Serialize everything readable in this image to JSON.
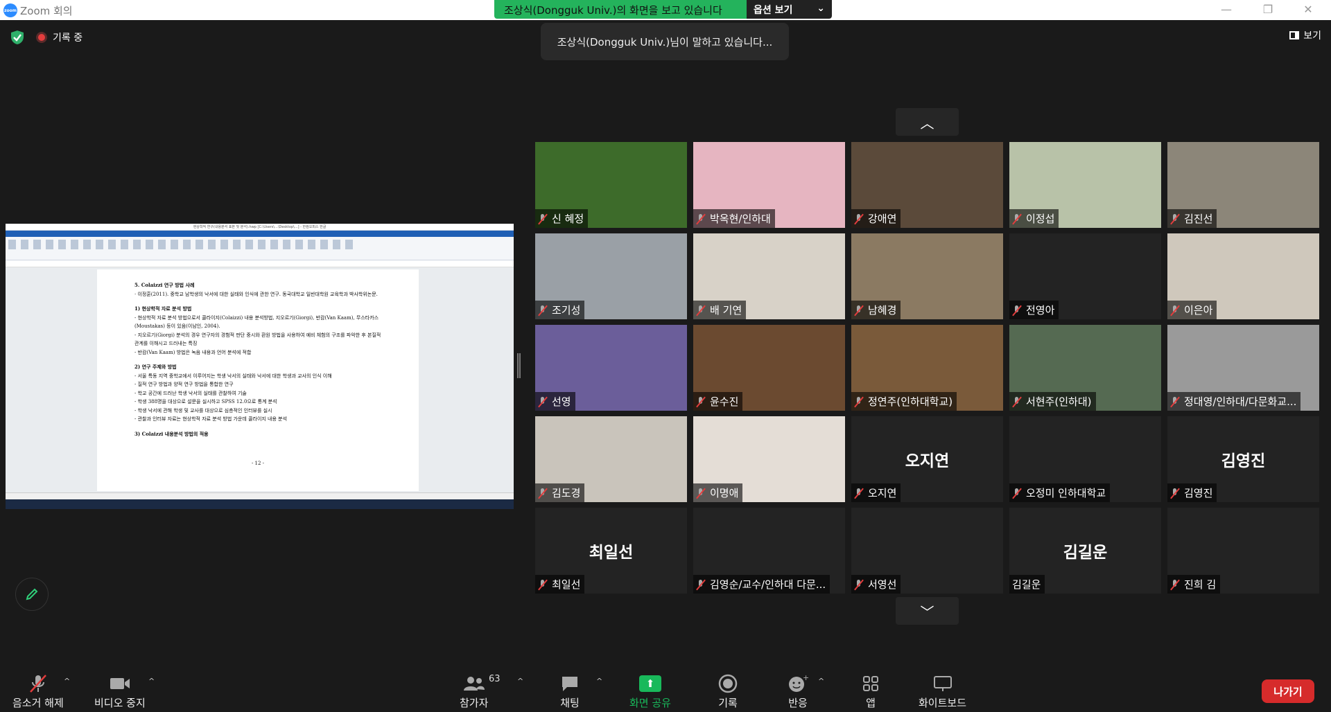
{
  "window": {
    "app_logo": "zoom",
    "title": "Zoom 회의",
    "minimize": "—",
    "restore": "❐",
    "close": "✕"
  },
  "share_banner": {
    "text": "조상식(Dongguk Univ.)의 화면을 보고 있습니다",
    "options_label": "옵션 보기",
    "options_caret": "⌄"
  },
  "recording_label": "기록 중",
  "speaking_text": "조상식(Dongguk Univ.)님이 말하고 있습니다...",
  "view_label": "보기",
  "shared_document": {
    "window_title": "현상학적 연구(내용분석 표본 및 분석).hwp [C:\\Users\\...\\Desktop\\...] - 한컴오피스 한글",
    "lines": [
      {
        "cls": "h",
        "text": "5. Colaizzi 연구 방법 사례"
      },
      {
        "cls": "",
        "text": "· 이정훈(2011). 중학교 남학생의 낙서에 대한 실태와 인식에 관한 연구. 동국대학교 일반대학원 교육학과 박사학위논문."
      },
      {
        "cls": "h",
        "text": "1) 현상학적 자료 분석 방법"
      },
      {
        "cls": "",
        "text": "- 현상학적 자료 분석 방법으로서 콜라이지(Colaizzi) 내용 분석방법, 지오르기(Giorgi), 반캄(Van Kaam), 무스타카스(Moustakas) 등이 있음(이남인, 2004)."
      },
      {
        "cls": "",
        "text": "- 지오르기(Giorgi) 분석의 경우 연구자의 경험적 판단 중시와 환원 방법을 사용하여 예비 체험의 구조를 파악한 후 본질적 관계를 이해시고 드러내는 특징"
      },
      {
        "cls": "",
        "text": "- 반캄(Van Kaam) 방법은 녹음 내용과 언어 분석에 적합"
      },
      {
        "cls": "h",
        "text": "2) 연구 주제와 방법"
      },
      {
        "cls": "",
        "text": "- 서울 특동 지역 중학교에서 이루어지는 학생 낙서의 실태와 낙서에 대한 학생과 교사의 인식 이해"
      },
      {
        "cls": "",
        "text": "- 질적 연구 방법과 양적 연구 방법을 통합한 연구"
      },
      {
        "cls": "",
        "text": "- 학교 공간에 드러난 학생 낙서의 실태를 관찰하여 기술"
      },
      {
        "cls": "",
        "text": "- 학생 388명을 대상으로 설문을 실시하고 SPSS 12.0으로 통계 분석"
      },
      {
        "cls": "",
        "text": "- 학생 낙서에 관해 학생 및 교사를 대상으로 심층적인 인터뷰를 실시"
      },
      {
        "cls": "",
        "text": "- 관찰과 인터뷰 자료는 현상학적 자료 분석 방법 가운데 콜라이지 내용 분석"
      },
      {
        "cls": "h",
        "text": "3) Colaizzi 내용분석 방법의 적용"
      },
      {
        "cls": "pg",
        "text": "- 12 -"
      }
    ]
  },
  "scroll_up": "︿",
  "scroll_down": "﹀",
  "participants": [
    {
      "name": "신 혜정",
      "muted": true,
      "bg": "#3d6b2a",
      "big": ""
    },
    {
      "name": "박옥현/인하대",
      "muted": true,
      "bg": "#e6b5c1",
      "big": ""
    },
    {
      "name": "강애연",
      "muted": true,
      "bg": "#5b4a3a",
      "big": ""
    },
    {
      "name": "이정섭",
      "muted": true,
      "bg": "#b8c2a8",
      "big": ""
    },
    {
      "name": "김진선",
      "muted": true,
      "bg": "#8c8679",
      "big": ""
    },
    {
      "name": "조기성",
      "muted": true,
      "bg": "#9aa0a6",
      "big": ""
    },
    {
      "name": "배 기연",
      "muted": true,
      "bg": "#d8d2c8",
      "big": ""
    },
    {
      "name": "남혜경",
      "muted": true,
      "bg": "#8b7a62",
      "big": ""
    },
    {
      "name": "전영아",
      "muted": true,
      "bg": "#232323",
      "big": ""
    },
    {
      "name": "이은아",
      "muted": true,
      "bg": "#cfc8bc",
      "big": ""
    },
    {
      "name": "선영",
      "muted": true,
      "bg": "#6b5e9a",
      "big": ""
    },
    {
      "name": "윤수진",
      "muted": true,
      "bg": "#6b4a30",
      "big": ""
    },
    {
      "name": "정연주(인하대학교)",
      "muted": true,
      "bg": "#7a5a3a",
      "big": ""
    },
    {
      "name": "서현주(인하대)",
      "muted": true,
      "bg": "#556a52",
      "big": ""
    },
    {
      "name": "정대영/인하대/다문화교...",
      "muted": true,
      "bg": "#9a9a9a",
      "big": ""
    },
    {
      "name": "김도경",
      "muted": true,
      "bg": "#c9c4bb",
      "big": ""
    },
    {
      "name": "이명애",
      "muted": true,
      "bg": "#e4ddd6",
      "big": ""
    },
    {
      "name": "오지연",
      "muted": true,
      "bg": "#232323",
      "big": "오지연"
    },
    {
      "name": "오정미 인하대학교",
      "muted": true,
      "bg": "#232323",
      "big": ""
    },
    {
      "name": "김영진",
      "muted": true,
      "bg": "#232323",
      "big": "김영진"
    },
    {
      "name": "최일선",
      "muted": true,
      "bg": "#232323",
      "big": "최일선"
    },
    {
      "name": "김영순/교수/인하대 다문...",
      "muted": true,
      "bg": "#232323",
      "big": ""
    },
    {
      "name": "서영선",
      "muted": true,
      "bg": "#232323",
      "big": ""
    },
    {
      "name": "김길운",
      "muted": false,
      "bg": "#232323",
      "big": "김길운"
    },
    {
      "name": "진희 김",
      "muted": true,
      "bg": "#232323",
      "big": ""
    }
  ],
  "toolbar": {
    "audio": "음소거 해제",
    "video": "비디오 중지",
    "participants": "참가자",
    "participants_count": "63",
    "chat": "채팅",
    "share": "화면 공유",
    "record": "기록",
    "reactions": "반응",
    "apps": "앱",
    "whiteboard": "화이트보드",
    "leave": "나가기",
    "caret": "^"
  },
  "colors": {
    "share_green": "#19b95b",
    "banner_green": "#24b35c",
    "leave_red": "#d62b2b"
  }
}
